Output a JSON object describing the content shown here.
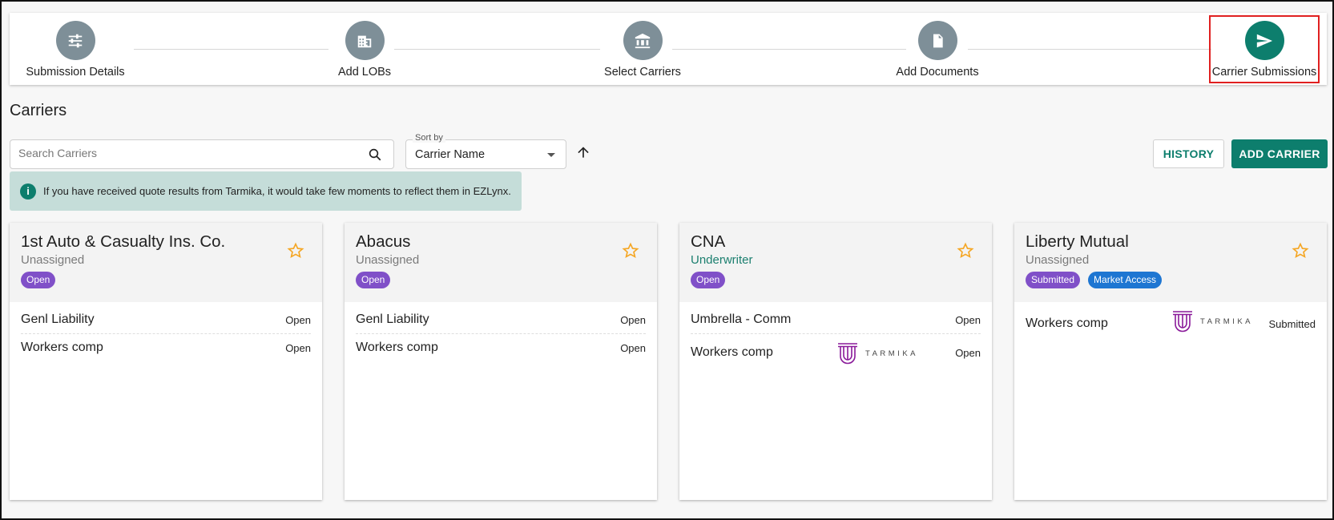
{
  "stepper": {
    "steps": [
      {
        "label": "Submission Details",
        "icon": "sliders-icon"
      },
      {
        "label": "Add LOBs",
        "icon": "building-icon"
      },
      {
        "label": "Select Carriers",
        "icon": "bank-icon"
      },
      {
        "label": "Add Documents",
        "icon": "document-icon"
      },
      {
        "label": "Carrier Submissions",
        "icon": "send-icon"
      }
    ],
    "active_index": 4
  },
  "carriers_section": {
    "title": "Carriers",
    "search": {
      "placeholder": "Search Carriers",
      "value": ""
    },
    "sort": {
      "label": "Sort by",
      "value": "Carrier Name",
      "direction": "ascending"
    },
    "history_label": "HISTORY",
    "add_carrier_label": "ADD CARRIER",
    "info_message": "If you have received quote results from Tarmika, it would take few moments to reflect them in EZLynx."
  },
  "colors": {
    "accent": "#0d7e6d",
    "step_inactive": "#7e8f98",
    "badge_purple": "#8050c8",
    "badge_blue": "#1e76d2",
    "star": "#f5a623",
    "tarmika": "#8a1a9a"
  },
  "cards": [
    {
      "name": "1st Auto & Casualty Ins. Co.",
      "assignee": "Unassigned",
      "badges": [
        "Open"
      ],
      "lobs": [
        {
          "name": "Genl Liability",
          "status": "Open",
          "tarmika": false
        },
        {
          "name": "Workers comp",
          "status": "Open",
          "tarmika": false
        }
      ]
    },
    {
      "name": "Abacus",
      "assignee": "Unassigned",
      "badges": [
        "Open"
      ],
      "lobs": [
        {
          "name": "Genl Liability",
          "status": "Open",
          "tarmika": false
        },
        {
          "name": "Workers comp",
          "status": "Open",
          "tarmika": false
        }
      ]
    },
    {
      "name": "CNA",
      "assignee": "Underwriter",
      "badges": [
        "Open"
      ],
      "lobs": [
        {
          "name": "Umbrella - Comm",
          "status": "Open",
          "tarmika": false
        },
        {
          "name": "Workers comp",
          "status": "Open",
          "tarmika": true
        }
      ]
    },
    {
      "name": "Liberty Mutual",
      "assignee": "Unassigned",
      "badges": [
        "Submitted",
        "Market Access"
      ],
      "lobs": [
        {
          "name": "Workers comp",
          "status": "Submitted",
          "tarmika": true
        }
      ]
    }
  ],
  "tarmika_wordmark": "TARMIKA"
}
